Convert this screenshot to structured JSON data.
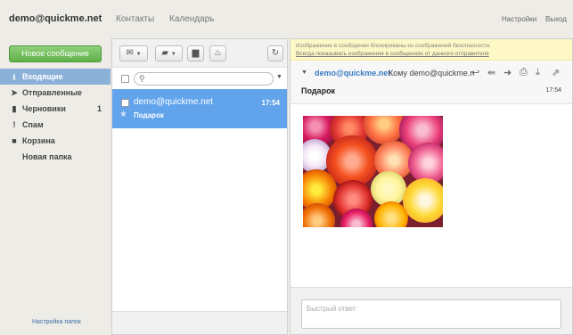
{
  "header": {
    "account": "demo@quickme.net",
    "nav": [
      "Контакты",
      "Календарь"
    ],
    "settings_label": "Настройки",
    "logout_label": "Выход"
  },
  "sidebar": {
    "compose_label": "Новое сообщение",
    "folders": [
      {
        "label": "Входящие",
        "icon": "inbox-icon",
        "glyph": "⭳",
        "count": "",
        "active": true
      },
      {
        "label": "Отправленные",
        "icon": "send-icon",
        "glyph": "➤",
        "count": "",
        "active": false
      },
      {
        "label": "Черновики",
        "icon": "draft-icon",
        "glyph": "▮",
        "count": "1",
        "active": false
      },
      {
        "label": "Спам",
        "icon": "spam-icon",
        "glyph": "❗",
        "count": "",
        "active": false
      },
      {
        "label": "Корзина",
        "icon": "trash-icon",
        "glyph": "🗑",
        "count": "",
        "active": false
      },
      {
        "label": "Новая папка",
        "icon": "",
        "glyph": "",
        "count": "",
        "active": false
      }
    ],
    "footer_link": "Настройка папок"
  },
  "toolbar": {
    "mark_icon": "envelope-icon",
    "move_icon": "folder-move-icon",
    "delete_icon": "trash-icon",
    "spam_icon": "flame-icon",
    "refresh_icon": "refresh-icon"
  },
  "search": {
    "placeholder": ""
  },
  "messages": [
    {
      "from": "demo@quickme.net",
      "time": "17:54",
      "subject": "Подарок",
      "selected": true
    }
  ],
  "reader": {
    "warning_text": "Изображения в сообщении блокированы из соображений безопасности.",
    "warning_link": "Всегда показывать изображения в сообщениях от данного отправителя",
    "sender": "demo@quickme.net",
    "to_text": "Кому demo@quickme.n",
    "subject": "Подарок",
    "time": "17:54",
    "actions": [
      "reply-icon",
      "reply-all-icon",
      "forward-icon",
      "print-icon",
      "download-icon",
      "open-external-icon"
    ],
    "quick_reply_placeholder": "Быстрый ответ"
  },
  "colors": {
    "accent": "#62a4ec",
    "compose": "#5fb04a",
    "active_folder": "#8cb1d8",
    "link": "#3a7cc4"
  }
}
